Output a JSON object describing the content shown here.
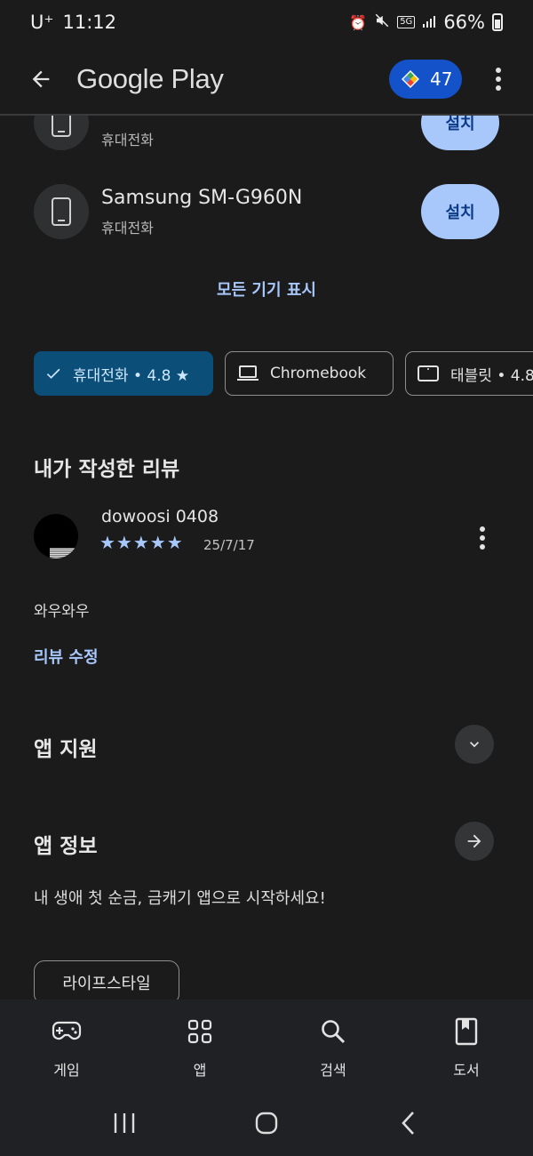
{
  "status": {
    "carrier": "U⁺",
    "time": "11:12",
    "network": "5G",
    "battery": "66%"
  },
  "app_bar": {
    "title": "Google Play",
    "points": "47"
  },
  "devices": [
    {
      "name": "Samsung SM-G960N",
      "type": "휴대전화",
      "action": "설치"
    }
  ],
  "partial_device": {
    "type": "휴대전화",
    "action": "설치"
  },
  "show_all_devices": "모든 기기 표시",
  "filters": [
    {
      "label": "휴대전화 • 4.8 ★",
      "selected": true
    },
    {
      "label": "Chromebook",
      "selected": false
    },
    {
      "label": "태블릿 • 4.8",
      "selected": false
    }
  ],
  "my_review": {
    "title": "내가 작성한 리뷰",
    "user": "dowoosi 0408",
    "stars": "★★★★★",
    "rating": 5,
    "date": "25/7/17",
    "text": "와우와우",
    "edit": "리뷰 수정"
  },
  "app_support": {
    "title": "앱 지원"
  },
  "app_info": {
    "title": "앱 정보",
    "description": "내 생애 첫 순금, 금캐기 앱으로 시작하세요!",
    "category": "라이프스타일"
  },
  "bottom_nav": [
    {
      "label": "게임",
      "icon": "gamepad-icon"
    },
    {
      "label": "앱",
      "icon": "apps-grid-icon"
    },
    {
      "label": "검색",
      "icon": "search-icon"
    },
    {
      "label": "도서",
      "icon": "book-icon"
    }
  ],
  "colors": {
    "accent": "#a8c7fa",
    "chip_selected": "#0b4f78",
    "points_chip": "#1452c9",
    "background": "#1b1b1c"
  }
}
